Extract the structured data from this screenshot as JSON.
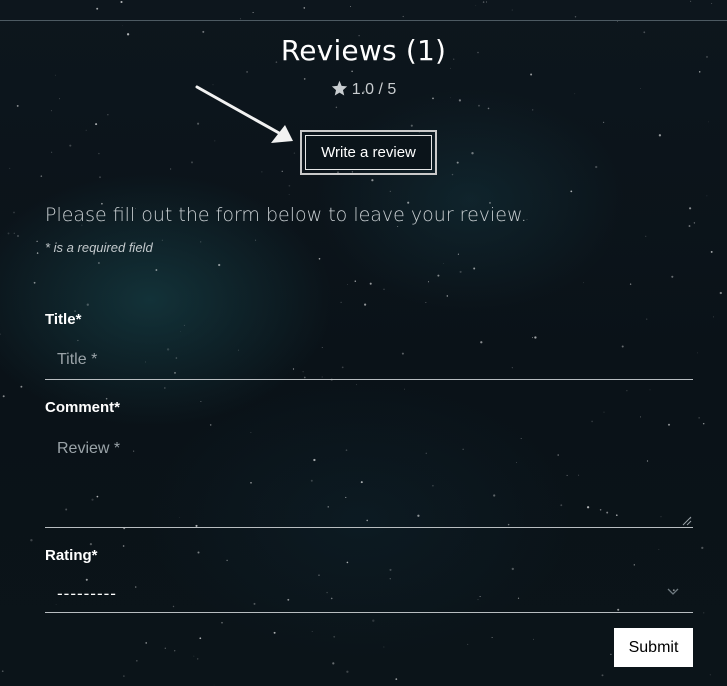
{
  "reviews": {
    "title": "Reviews (1)",
    "rating_icon": "star-icon",
    "rating_text": "1.0 / 5",
    "write_review_label": "Write a review"
  },
  "form": {
    "intro": "Please fill out the form below to leave your review.",
    "required_note": "* is a required field",
    "title_label": "Title*",
    "title_placeholder": "Title *",
    "comment_label": "Comment*",
    "comment_placeholder": "Review *",
    "rating_label": "Rating*",
    "rating_selected": "---------",
    "submit_label": "Submit"
  },
  "colors": {
    "background": "#0b141a",
    "text": "#ffffff",
    "muted": "#9aa3a8",
    "button": "#ffffff"
  }
}
